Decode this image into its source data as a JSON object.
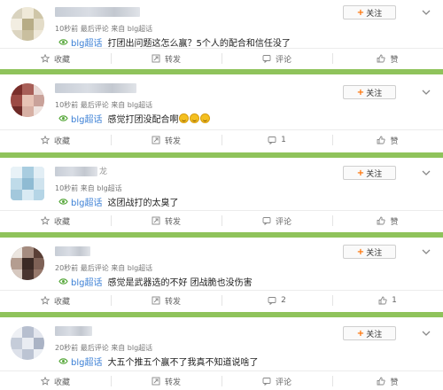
{
  "follow_label": "关注",
  "colors": {
    "accent": "#3a7fd5",
    "separator": "#8fc35b",
    "follow_plus": "#ff6f00"
  },
  "posts": [
    {
      "meta": "10秒前 最后评论 来自 blg超话",
      "tag": "blg超话",
      "text": "打团出问题这怎么赢？5个人的配合和信任没了",
      "actions": {
        "collect": "收藏",
        "repost": "转发",
        "comment": "评论",
        "like": "赞"
      }
    },
    {
      "meta": "10秒前 最后评论 来自 blg超话",
      "tag": "blg超话",
      "text": "感觉打团没配合啊",
      "emoji_count": 3,
      "actions": {
        "collect": "收藏",
        "repost": "转发",
        "comment": "1",
        "like": "赞"
      }
    },
    {
      "meta": "10秒前 来自 blg超话",
      "tag": "blg超话",
      "text": "这团战打的太臭了",
      "name_suffix": "龙",
      "actions": {
        "collect": "收藏",
        "repost": "转发",
        "comment": "评论",
        "like": "赞"
      }
    },
    {
      "meta": "20秒前 最后评论 来自 blg超话",
      "tag": "blg超话",
      "text": "感觉是武器选的不好 团战脆也没伤害",
      "actions": {
        "collect": "收藏",
        "repost": "转发",
        "comment": "2",
        "like": "1"
      }
    },
    {
      "meta": "20秒前 最后评论 来自 blg超话",
      "tag": "blg超话",
      "text": "大五个推五个赢不了我真不知道说啥了",
      "actions": {
        "collect": "收藏",
        "repost": "转发",
        "comment": "评论",
        "like": "赞"
      }
    }
  ]
}
